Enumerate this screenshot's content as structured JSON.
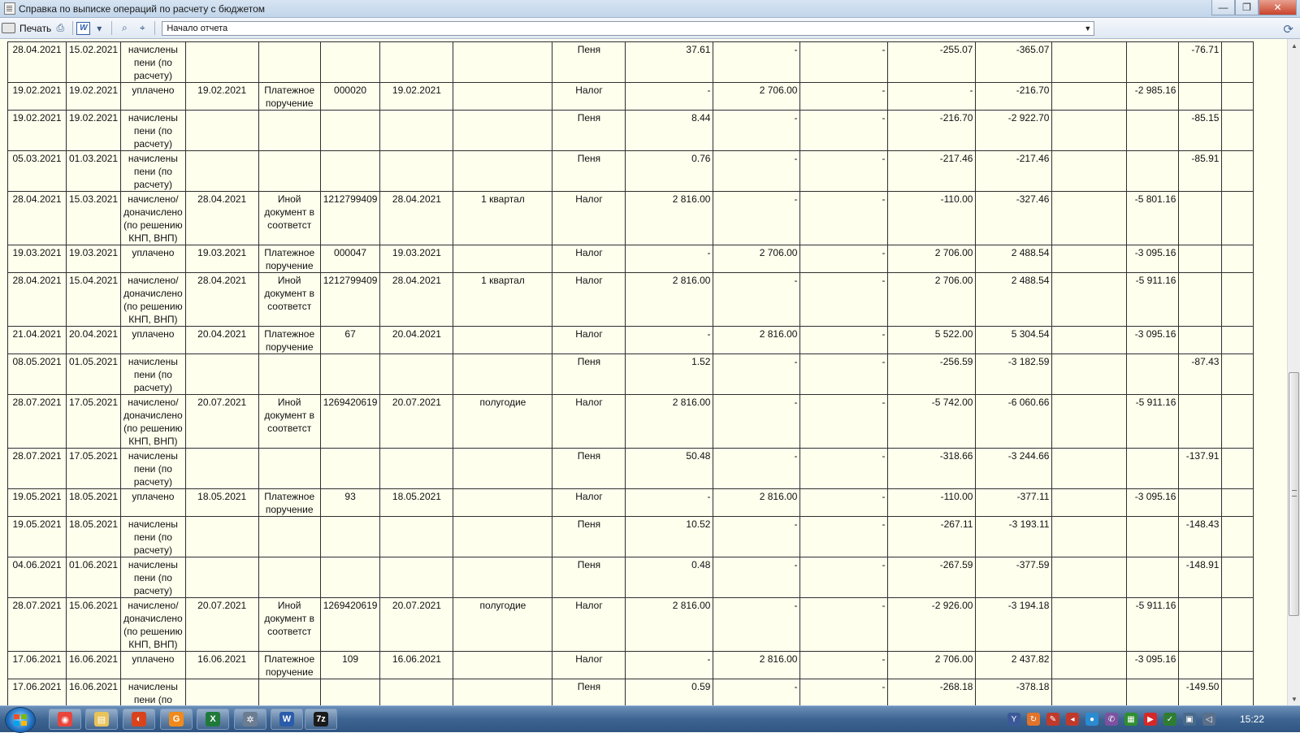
{
  "window": {
    "title": "Справка по выписке операций по расчету с бюджетом",
    "controls": [
      "—",
      "❐",
      "✕"
    ]
  },
  "toolbar": {
    "print_label": "Печать",
    "word_label": "W",
    "section_select": "Начало отчета"
  },
  "table": {
    "rows": [
      [
        "28.04.2021",
        "15.02.2021",
        "начислены пени (по расчету)",
        "",
        "",
        "",
        "",
        "",
        "Пеня",
        "37.61",
        "-",
        "-",
        "-255.07",
        "-365.07",
        "",
        "",
        "-76.71",
        ""
      ],
      [
        "19.02.2021",
        "19.02.2021",
        "уплачено",
        "19.02.2021",
        "Платежное поручение",
        "000020",
        "19.02.2021",
        "",
        "Налог",
        "-",
        "2 706.00",
        "-",
        "-",
        "-216.70",
        "",
        "-2 985.16",
        "",
        ""
      ],
      [
        "19.02.2021",
        "19.02.2021",
        "начислены пени (по расчету)",
        "",
        "",
        "",
        "",
        "",
        "Пеня",
        "8.44",
        "-",
        "-",
        "-216.70",
        "-2 922.70",
        "",
        "",
        "-85.15",
        ""
      ],
      [
        "05.03.2021",
        "01.03.2021",
        "начислены пени (по расчету)",
        "",
        "",
        "",
        "",
        "",
        "Пеня",
        "0.76",
        "-",
        "-",
        "-217.46",
        "-217.46",
        "",
        "",
        "-85.91",
        ""
      ],
      [
        "28.04.2021",
        "15.03.2021",
        "начислено/ доначислено (по решению КНП, ВНП)",
        "28.04.2021",
        "Иной документ в соответст",
        "1212799409",
        "28.04.2021",
        "1 квартал",
        "Налог",
        "2 816.00",
        "-",
        "-",
        "-110.00",
        "-327.46",
        "",
        "-5 801.16",
        "",
        ""
      ],
      [
        "19.03.2021",
        "19.03.2021",
        "уплачено",
        "19.03.2021",
        "Платежное поручение",
        "000047",
        "19.03.2021",
        "",
        "Налог",
        "-",
        "2 706.00",
        "-",
        "2 706.00",
        "2 488.54",
        "",
        "-3 095.16",
        "",
        ""
      ],
      [
        "28.04.2021",
        "15.04.2021",
        "начислено/ доначислено (по решению КНП, ВНП)",
        "28.04.2021",
        "Иной документ в соответст",
        "1212799409",
        "28.04.2021",
        "1 квартал",
        "Налог",
        "2 816.00",
        "-",
        "-",
        "2 706.00",
        "2 488.54",
        "",
        "-5 911.16",
        "",
        ""
      ],
      [
        "21.04.2021",
        "20.04.2021",
        "уплачено",
        "20.04.2021",
        "Платежное поручение",
        "67",
        "20.04.2021",
        "",
        "Налог",
        "-",
        "2 816.00",
        "-",
        "5 522.00",
        "5 304.54",
        "",
        "-3 095.16",
        "",
        ""
      ],
      [
        "08.05.2021",
        "01.05.2021",
        "начислены пени (по расчету)",
        "",
        "",
        "",
        "",
        "",
        "Пеня",
        "1.52",
        "-",
        "-",
        "-256.59",
        "-3 182.59",
        "",
        "",
        "-87.43",
        ""
      ],
      [
        "28.07.2021",
        "17.05.2021",
        "начислено/ доначислено (по решению КНП, ВНП)",
        "20.07.2021",
        "Иной документ в соответст",
        "1269420619",
        "20.07.2021",
        "полугодие",
        "Налог",
        "2 816.00",
        "-",
        "-",
        "-5 742.00",
        "-6 060.66",
        "",
        "-5 911.16",
        "",
        ""
      ],
      [
        "28.07.2021",
        "17.05.2021",
        "начислены пени (по расчету)",
        "",
        "",
        "",
        "",
        "",
        "Пеня",
        "50.48",
        "-",
        "-",
        "-318.66",
        "-3 244.66",
        "",
        "",
        "-137.91",
        ""
      ],
      [
        "19.05.2021",
        "18.05.2021",
        "уплачено",
        "18.05.2021",
        "Платежное поручение",
        "93",
        "18.05.2021",
        "",
        "Налог",
        "-",
        "2 816.00",
        "-",
        "-110.00",
        "-377.11",
        "",
        "-3 095.16",
        "",
        ""
      ],
      [
        "19.05.2021",
        "18.05.2021",
        "начислены пени (по расчету)",
        "",
        "",
        "",
        "",
        "",
        "Пеня",
        "10.52",
        "-",
        "-",
        "-267.11",
        "-3 193.11",
        "",
        "",
        "-148.43",
        ""
      ],
      [
        "04.06.2021",
        "01.06.2021",
        "начислены пени (по расчету)",
        "",
        "",
        "",
        "",
        "",
        "Пеня",
        "0.48",
        "-",
        "-",
        "-267.59",
        "-377.59",
        "",
        "",
        "-148.91",
        ""
      ],
      [
        "28.07.2021",
        "15.06.2021",
        "начислено/ доначислено (по решению КНП, ВНП)",
        "20.07.2021",
        "Иной документ в соответст",
        "1269420619",
        "20.07.2021",
        "полугодие",
        "Налог",
        "2 816.00",
        "-",
        "-",
        "-2 926.00",
        "-3 194.18",
        "",
        "-5 911.16",
        "",
        ""
      ],
      [
        "17.06.2021",
        "16.06.2021",
        "уплачено",
        "16.06.2021",
        "Платежное поручение",
        "109",
        "16.06.2021",
        "",
        "Налог",
        "-",
        "2 816.00",
        "-",
        "2 706.00",
        "2 437.82",
        "",
        "-3 095.16",
        "",
        ""
      ],
      [
        "17.06.2021",
        "16.06.2021",
        "начислены пени (по расчету)",
        "",
        "",
        "",
        "",
        "",
        "Пеня",
        "0.59",
        "-",
        "-",
        "-268.18",
        "-378.18",
        "",
        "",
        "-149.50",
        ""
      ]
    ]
  },
  "taskbar": {
    "apps": [
      {
        "name": "chrome-icon",
        "glyph": "◉",
        "color": "#e8453c"
      },
      {
        "name": "file-explorer-icon",
        "glyph": "▤",
        "color": "#e8c35a"
      },
      {
        "name": "pdf-reader-icon",
        "glyph": "◐",
        "color": "#d9431c"
      },
      {
        "name": "app-g-icon",
        "glyph": "G",
        "color": "#f08a1d"
      },
      {
        "name": "excel-icon",
        "glyph": "X",
        "color": "#1f7a3a"
      },
      {
        "name": "settings-app-icon",
        "glyph": "✲",
        "color": "#6c7d92"
      },
      {
        "name": "word-icon",
        "glyph": "W",
        "color": "#2b5cab"
      },
      {
        "name": "7zip-icon",
        "glyph": "7z",
        "color": "#1b1b1b"
      }
    ],
    "tray": [
      {
        "name": "yandex-tray-icon",
        "glyph": "Y",
        "color": "#3b5998"
      },
      {
        "name": "update-tray-icon",
        "glyph": "↻",
        "color": "#e2732b"
      },
      {
        "name": "tool-tray-icon",
        "glyph": "✎",
        "color": "#c0392b"
      },
      {
        "name": "sound-alert-tray-icon",
        "glyph": "◂",
        "color": "#c0392b"
      },
      {
        "name": "messenger-tray-icon",
        "glyph": "●",
        "color": "#2a8bd1"
      },
      {
        "name": "viber-tray-icon",
        "glyph": "✆",
        "color": "#7d51a0"
      },
      {
        "name": "antivirus-tray-icon",
        "glyph": "▦",
        "color": "#2f8f2f"
      },
      {
        "name": "video-tray-icon",
        "glyph": "▶",
        "color": "#d62828"
      },
      {
        "name": "network-status-tray-icon",
        "glyph": "✓",
        "color": "#2e7d32"
      },
      {
        "name": "network-tray-icon",
        "glyph": "▣",
        "color": "#4a6a8a"
      },
      {
        "name": "volume-tray-icon",
        "glyph": "◁",
        "color": "#5a6f8a"
      }
    ],
    "time": "15:22"
  }
}
